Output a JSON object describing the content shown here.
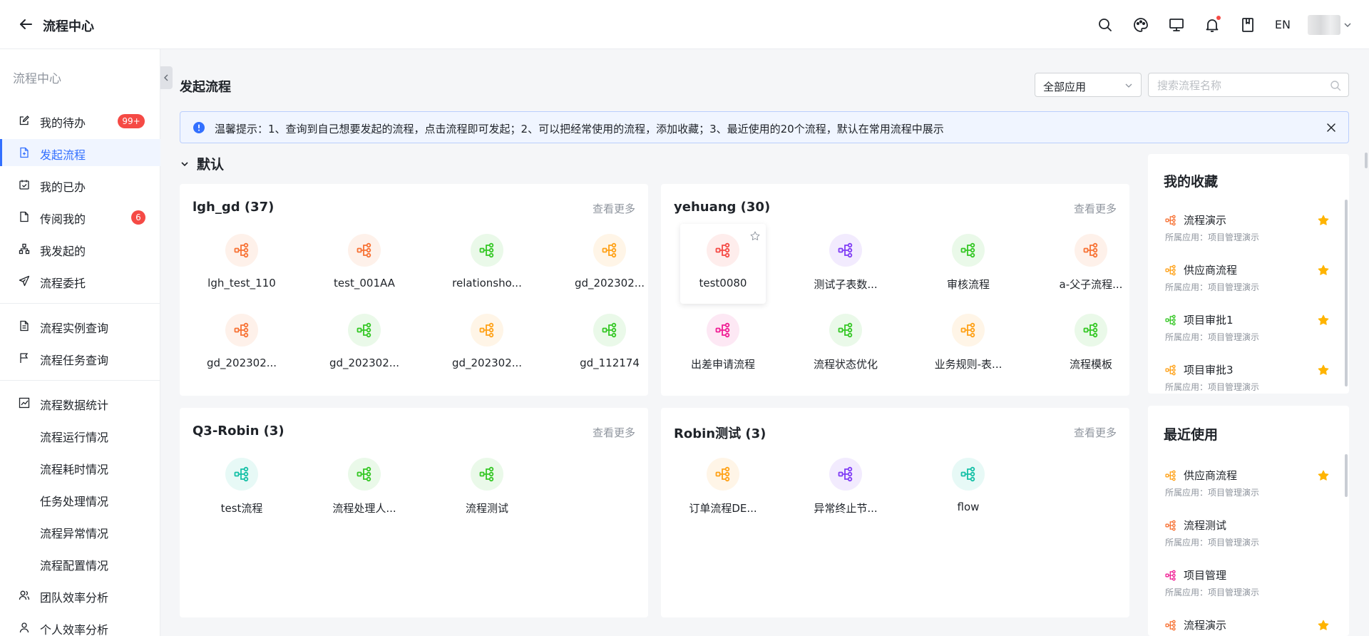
{
  "app": {
    "title": "流程中心",
    "lang": "EN"
  },
  "sidebar": {
    "title": "流程中心",
    "items": [
      {
        "label": "我的待办",
        "icon": "edit-icon",
        "badge": "99+"
      },
      {
        "label": "发起流程",
        "icon": "file-add-icon",
        "active": true
      },
      {
        "label": "我的已办",
        "icon": "calendar-check-icon"
      },
      {
        "label": "传阅我的",
        "icon": "file-icon",
        "badge": "6"
      },
      {
        "label": "我发起的",
        "icon": "org-chart-icon"
      },
      {
        "label": "流程委托",
        "icon": "send-icon"
      },
      {
        "label": "流程实例查询",
        "icon": "file-search-icon"
      },
      {
        "label": "流程任务查询",
        "icon": "flag-icon"
      },
      {
        "label": "流程数据统计",
        "icon": "chart-icon"
      },
      {
        "label": "流程运行情况"
      },
      {
        "label": "流程耗时情况"
      },
      {
        "label": "任务处理情况"
      },
      {
        "label": "流程异常情况"
      },
      {
        "label": "流程配置情况"
      },
      {
        "label": "团队效率分析",
        "icon": "team-icon"
      },
      {
        "label": "个人效率分析",
        "icon": "user-icon"
      }
    ]
  },
  "main": {
    "title": "发起流程",
    "app_filter": "全部应用",
    "search_placeholder": "搜索流程名称",
    "tip": "温馨提示：1、查询到自己想要发起的流程，点击流程即可发起；2、可以把经常使用的流程，添加收藏；3、最近使用的20个流程，默认在常用流程中展示",
    "group": "默认",
    "more_label": "查看更多",
    "cards": [
      {
        "title": "lgh_gd (37)",
        "flows": [
          {
            "name": "lgh_test_110",
            "color": "#f77234"
          },
          {
            "name": "test_001AA",
            "color": "#f77234"
          },
          {
            "name": "relationsho...",
            "color": "#34c724"
          },
          {
            "name": "gd_202302...",
            "color": "#ffa116"
          },
          {
            "name": "gd_202302...",
            "color": "#f77234"
          },
          {
            "name": "gd_202302...",
            "color": "#34c724"
          },
          {
            "name": "gd_202302...",
            "color": "#ffa116"
          },
          {
            "name": "gd_112174",
            "color": "#34c724"
          }
        ]
      },
      {
        "title": "yehuang (30)",
        "flows": [
          {
            "name": "test0080",
            "color": "#f54a45"
          },
          {
            "name": "测试子表数...",
            "color": "#7f3bf5"
          },
          {
            "name": "审核流程",
            "color": "#34c724"
          },
          {
            "name": "a-父子流程...",
            "color": "#f77234"
          },
          {
            "name": "出差申请流程",
            "color": "#f01d94"
          },
          {
            "name": "流程状态优化",
            "color": "#34c724"
          },
          {
            "name": "业务规则-表...",
            "color": "#ffa116"
          },
          {
            "name": "流程模板",
            "color": "#34c724"
          }
        ]
      },
      {
        "title": "Q3-Robin (3)",
        "flows": [
          {
            "name": "test流程",
            "color": "#14c0a6"
          },
          {
            "name": "流程处理人...",
            "color": "#34c724"
          },
          {
            "name": "流程测试",
            "color": "#34c724"
          }
        ]
      },
      {
        "title": "Robin测试 (3)",
        "flows": [
          {
            "name": "订单流程DE...",
            "color": "#ffa116"
          },
          {
            "name": "异常终止节...",
            "color": "#7f3bf5"
          },
          {
            "name": "flow",
            "color": "#14c0a6"
          }
        ]
      }
    ]
  },
  "favorites": {
    "title": "我的收藏",
    "items": [
      {
        "name": "流程演示",
        "sub": "所属应用：项目管理演示",
        "color": "#f77234"
      },
      {
        "name": "供应商流程",
        "sub": "所属应用：项目管理演示",
        "color": "#ffa116"
      },
      {
        "name": "项目审批1",
        "sub": "所属应用：项目管理演示",
        "color": "#34c724"
      },
      {
        "name": "项目审批3",
        "sub": "所属应用：项目管理演示",
        "color": "#ffa116"
      }
    ]
  },
  "recent": {
    "title": "最近使用",
    "items": [
      {
        "name": "供应商流程",
        "sub": "所属应用：项目管理演示",
        "color": "#ffa116",
        "starred": true
      },
      {
        "name": "流程测试",
        "sub": "所属应用：项目管理演示",
        "color": "#f77234",
        "starred": false
      },
      {
        "name": "项目管理",
        "sub": "所属应用：项目管理演示",
        "color": "#f01d94",
        "starred": false
      },
      {
        "name": "流程演示",
        "sub": "",
        "color": "#f77234",
        "starred": true
      }
    ]
  },
  "colors": {
    "accent": "#3370ff",
    "badge": "#f54a45",
    "star": "#ffb400"
  }
}
